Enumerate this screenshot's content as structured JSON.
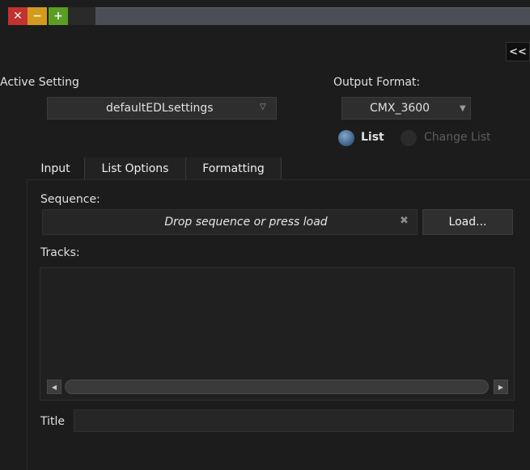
{
  "window": {
    "close_glyph": "✕",
    "minimize_glyph": "−",
    "maximize_glyph": "+"
  },
  "collapse_label": "<<",
  "active_setting": {
    "label": "Active Setting",
    "value": "defaultEDLsettings"
  },
  "output_format": {
    "label": "Output Format:",
    "value": "CMX_3600",
    "options": [
      "List",
      "Change List"
    ],
    "selected": "List"
  },
  "tabs": [
    "Input",
    "List Options",
    "Formatting"
  ],
  "active_tab": "Input",
  "input": {
    "sequence_label": "Sequence:",
    "sequence_placeholder": "Drop sequence or press load",
    "clear_glyph": "✖",
    "load_label": "Load...",
    "tracks_label": "Tracks:",
    "title_label": "Title",
    "title_value": ""
  },
  "icons": {
    "scroll_left": "scroll-left-arrow-icon",
    "scroll_right": "scroll-right-arrow-icon"
  }
}
